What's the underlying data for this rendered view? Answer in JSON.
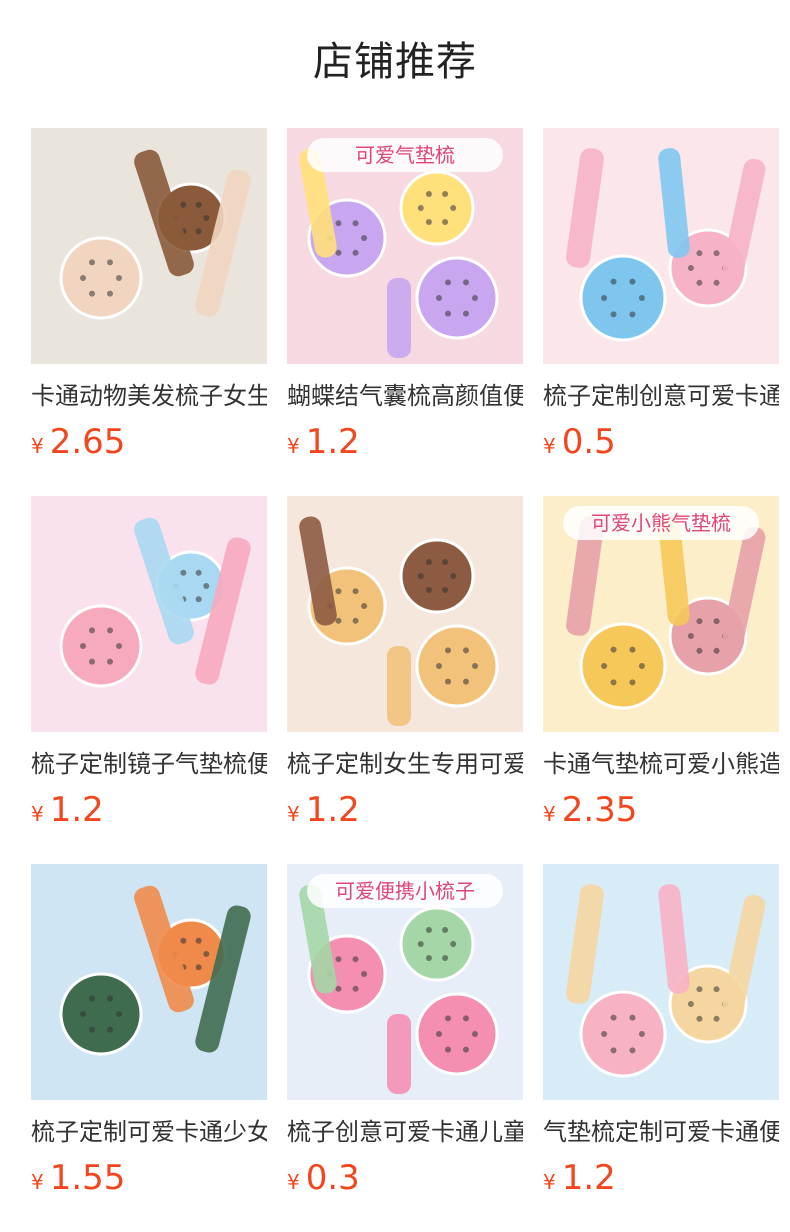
{
  "header": {
    "title": "店铺推荐"
  },
  "products": [
    {
      "name": "卡通动物美发梳子女生专用",
      "currency": "¥",
      "price": "2.65",
      "image": {
        "bg": "#e9e4dc",
        "accent": "#f1d5c0",
        "accent2": "#8a5a3a",
        "caption": ""
      }
    },
    {
      "name": "蝴蝶结气囊梳高颜值便携",
      "currency": "¥",
      "price": "1.2",
      "image": {
        "bg": "#f7d9e2",
        "accent": "#c8a6f0",
        "accent2": "#ffe07a",
        "caption": "可爱气垫梳"
      }
    },
    {
      "name": "梳子定制创意可爱卡通",
      "currency": "¥",
      "price": "0.5",
      "image": {
        "bg": "#fbe6ea",
        "accent": "#7fc6ef",
        "accent2": "#f6b3c8",
        "caption": ""
      }
    },
    {
      "name": "梳子定制镜子气垫梳便携",
      "currency": "¥",
      "price": "1.2",
      "image": {
        "bg": "#f9e1ee",
        "accent": "#f7a9be",
        "accent2": "#a9d9f2",
        "caption": ""
      }
    },
    {
      "name": "梳子定制女生专用可爱",
      "currency": "¥",
      "price": "1.2",
      "image": {
        "bg": "#f6e7dc",
        "accent": "#f2c27a",
        "accent2": "#8d5b42",
        "caption": ""
      }
    },
    {
      "name": "卡通气垫梳可爱小熊造型",
      "currency": "¥",
      "price": "2.35",
      "image": {
        "bg": "#fbeec9",
        "accent": "#f6c85a",
        "accent2": "#e7a1a9",
        "caption": "可爱小熊气垫梳"
      }
    },
    {
      "name": "梳子定制可爱卡通少女心",
      "currency": "¥",
      "price": "1.55",
      "image": {
        "bg": "#cfe5f3",
        "accent": "#3f6b4f",
        "accent2": "#f08a4b",
        "caption": ""
      }
    },
    {
      "name": "梳子创意可爱卡通儿童",
      "currency": "¥",
      "price": "0.3",
      "image": {
        "bg": "#e7eef8",
        "accent": "#f48fb1",
        "accent2": "#a5d6a7",
        "caption": "可爱便携小梳子"
      }
    },
    {
      "name": "气垫梳定制可爱卡通便携",
      "currency": "¥",
      "price": "1.2",
      "image": {
        "bg": "#d7ecf7",
        "accent": "#f7b2c4",
        "accent2": "#f6d6a0",
        "caption": ""
      }
    }
  ]
}
